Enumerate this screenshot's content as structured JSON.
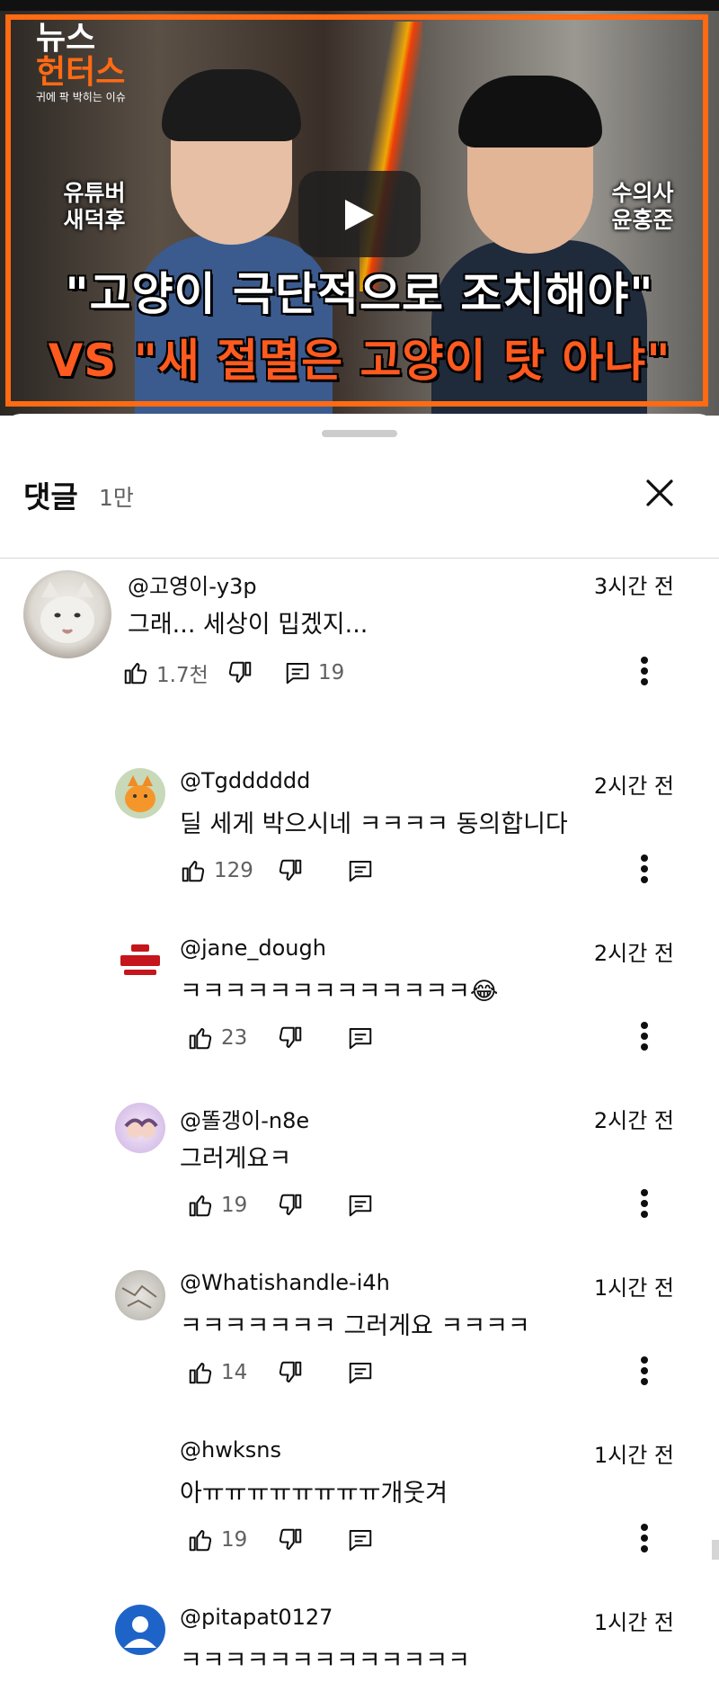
{
  "video": {
    "brand_line1": "뉴스",
    "brand_line2": "헌터스",
    "brand_sub": "귀에 팍 박히는 이슈",
    "left_tag": "유튜버 새덕후",
    "right_tag": "수의사 윤홍준",
    "headline_1": "\"고양이 극단적으로 조치해야\"",
    "headline_2": "VS \"새 절멸은 고양이 탓 아냐\"",
    "accent_color": "#ff6a13"
  },
  "comments_sheet": {
    "title": "댓글",
    "count": "1만",
    "close_icon": "close-icon"
  },
  "comments": [
    {
      "author": "@고영이-y3p",
      "time": "3시간 전",
      "text": "그래... 세상이 밉겠지...",
      "likes": "1.7천",
      "replies": "19",
      "avatar": "white-cat-photo"
    },
    {
      "author": "@Tgdddddd",
      "time": "2시간 전",
      "text": "딜 세게 박으시네 ㅋㅋㅋㅋ 동의합니다",
      "likes": "129",
      "avatar": "orange-cat-illustration"
    },
    {
      "author": "@jane_dough",
      "time": "2시간 전",
      "text": "ㅋㅋㅋㅋㅋㅋㅋㅋㅋㅋㅋㅋㅋ😂",
      "likes": "23",
      "avatar": "red-logo"
    },
    {
      "author": "@똘갱이-n8e",
      "time": "2시간 전",
      "text": "그러게요ㅋ",
      "likes": "19",
      "avatar": "pastel-illustration"
    },
    {
      "author": "@Whatishandle-i4h",
      "time": "1시간 전",
      "text": "ㅋㅋㅋㅋㅋㅋㅋ 그러게요 ㅋㅋㅋㅋ",
      "likes": "14",
      "avatar": "gray-texture"
    },
    {
      "author": "@hwksns",
      "time": "1시간 전",
      "text": "아ㅠㅠㅠㅠㅠㅠㅠㅠ개웃겨",
      "likes": "19",
      "avatar": "none"
    },
    {
      "author": "@pitapat0127",
      "time": "1시간 전",
      "text": "ㅋㅋㅋㅋㅋㅋㅋㅋㅋㅋㅋㅋㅋ",
      "avatar": "default-person"
    }
  ]
}
